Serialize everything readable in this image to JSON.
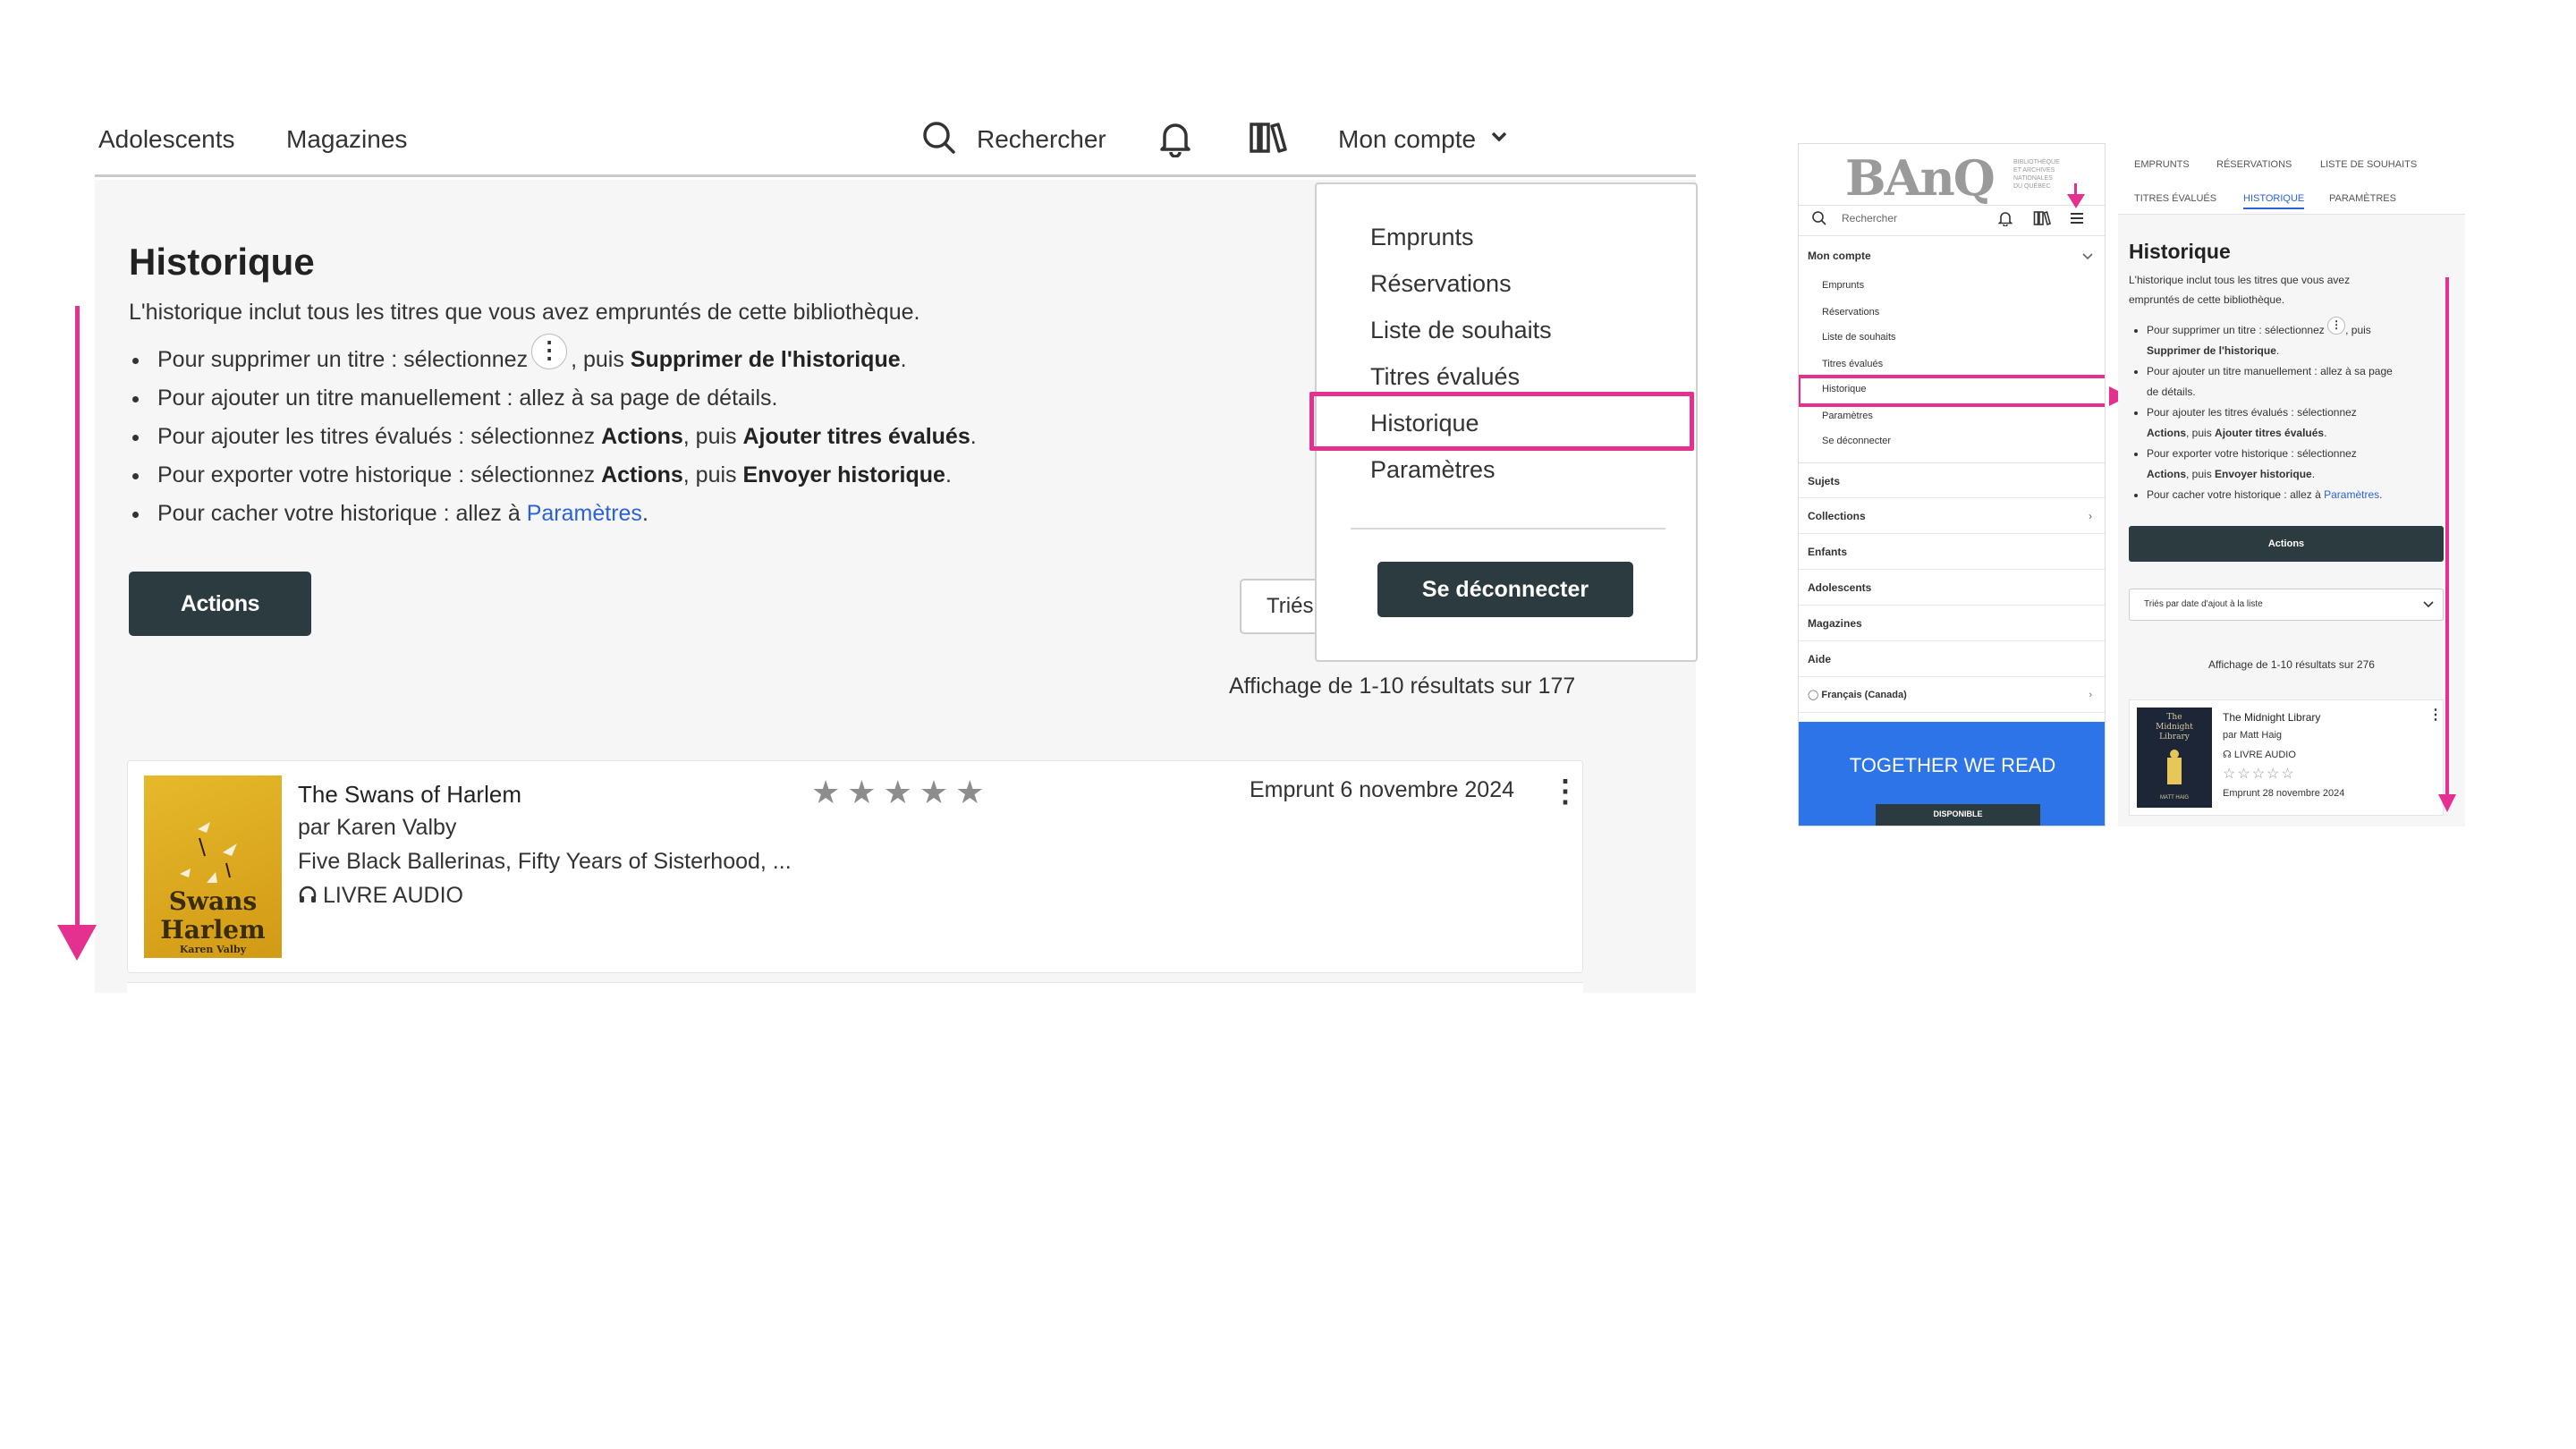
{
  "desktop": {
    "nav": {
      "links": [
        "Adolescents",
        "Magazines"
      ],
      "search_label": "Rechercher",
      "account_label": "Mon compte"
    },
    "page_title": "Historique",
    "intro": "L'historique inclut tous les titres que vous avez empruntés de cette bibliothèque.",
    "bullets": [
      {
        "pre": "Pour supprimer un titre : sélectionnez",
        "mid": ", puis ",
        "bold": "Supprimer de l'historique",
        "post": "."
      },
      {
        "text": "Pour ajouter un titre manuellement : allez à sa page de détails."
      },
      {
        "pre": "Pour ajouter les titres évalués : sélectionnez ",
        "b1": "Actions",
        "mid": ", puis ",
        "b2": "Ajouter titres évalués",
        "post": "."
      },
      {
        "pre": "Pour exporter votre historique : sélectionnez ",
        "b1": "Actions",
        "mid": ", puis ",
        "b2": "Envoyer historique",
        "post": "."
      },
      {
        "pre": "Pour cacher votre historique : allez à ",
        "link": "Paramètres",
        "post": "."
      }
    ],
    "actions_label": "Actions",
    "sort_label": "Triés",
    "result_count": "Affichage de 1-10 résultats sur 177",
    "book": {
      "title": "The Swans of Harlem",
      "author": "par Karen Valby",
      "subtitle": "Five Black Ballerinas, Fifty Years of Sisterhood, ...",
      "format": "LIVRE AUDIO",
      "loan_date": "Emprunt 6 novembre 2024",
      "rating": 0,
      "rating_max": 5,
      "cover_title_1": "Swans",
      "cover_title_2": "Harlem",
      "cover_author": "Karen Valby"
    },
    "dropdown": {
      "items": [
        "Emprunts",
        "Réservations",
        "Liste de souhaits",
        "Titres évalués",
        "Historique",
        "Paramètres"
      ],
      "highlighted": "Historique",
      "logout_label": "Se déconnecter"
    }
  },
  "mobile_menu": {
    "logo": "BAnQ",
    "logo_sub": [
      "BIBLIOTHÈQUE",
      "ET ARCHIVES",
      "NATIONALES",
      "DU QUÉBEC"
    ],
    "search_label": "Rechercher",
    "account_label": "Mon compte",
    "account_items": [
      "Emprunts",
      "Réservations",
      "Liste de souhaits",
      "Titres évalués",
      "Historique",
      "Paramètres",
      "Se déconnecter"
    ],
    "sections": [
      "Sujets",
      "Collections",
      "Enfants",
      "Adolescents",
      "Magazines",
      "Aide"
    ],
    "language": "Français (Canada)",
    "banner_title": "TOGETHER WE READ",
    "banner_badge": "DISPONIBLE"
  },
  "mobile_history": {
    "tabs": [
      "EMPRUNTS",
      "RÉSERVATIONS",
      "LISTE DE SOUHAITS",
      "TITRES ÉVALUÉS",
      "HISTORIQUE",
      "PARAMÈTRES"
    ],
    "active_tab": "HISTORIQUE",
    "title": "Historique",
    "intro_1": "L'historique inclut tous les titres que vous avez",
    "intro_2": "empruntés de cette bibliothèque.",
    "b1_pre": "Pour supprimer un titre : sélectionnez",
    "b1_post": ", puis",
    "b1_bold": "Supprimer de l'historique",
    "b2_1": "Pour ajouter un titre manuellement : allez à sa page",
    "b2_2": "de détails.",
    "b3_1": "Pour ajouter les titres évalués : sélectionnez",
    "b3_b1": "Actions",
    "b3_mid": ", puis ",
    "b3_b2": "Ajouter titres évalués",
    "b4_1": "Pour exporter votre historique : sélectionnez",
    "b4_b1": "Actions",
    "b4_mid": ", puis ",
    "b4_b2": "Envoyer historique",
    "b5_pre": "Pour cacher votre historique : allez à ",
    "b5_link": "Paramètres",
    "actions_label": "Actions",
    "sort_label": "Triés par date d'ajout à la liste",
    "result_count": "Affichage de 1-10 résultats sur 276",
    "book": {
      "title": "The Midnight Library",
      "author": "par Matt Haig",
      "format": "LIVRE AUDIO",
      "loan_date": "Emprunt 28 novembre 2024",
      "rating": 0,
      "rating_max": 5,
      "cover_text_1": "The",
      "cover_text_2": "Midnight",
      "cover_text_3": "Library",
      "cover_author": "MATT HAIG"
    }
  },
  "colors": {
    "accent": "#e4308f",
    "dark_button": "#2b3b3f",
    "link": "#2b62d8",
    "banner": "#2d74e9"
  }
}
